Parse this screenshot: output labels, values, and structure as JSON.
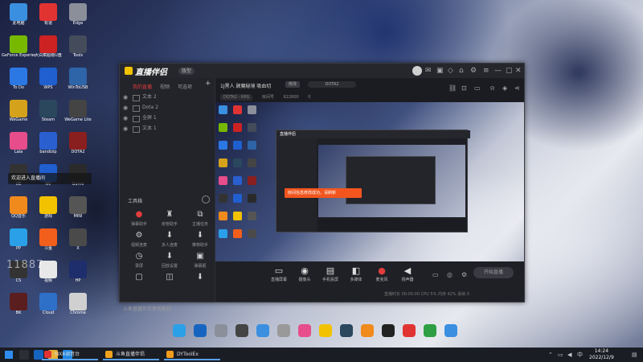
{
  "desktop": {
    "icons": [
      {
        "label": "此电脑",
        "color": "#3b8fe0"
      },
      {
        "label": "有道",
        "color": "#e23333"
      },
      {
        "label": "Edge",
        "color": "#8a8f9a"
      },
      {
        "label": "GeForce Experience",
        "color": "#76b900"
      },
      {
        "label": "大白菜超级U盘",
        "color": "#cc2222"
      },
      {
        "label": "Tools",
        "color": "#444b5a"
      },
      {
        "label": "To Do",
        "color": "#2b78e4"
      },
      {
        "label": "WPS",
        "color": "#1f5fcf"
      },
      {
        "label": "WinToUSB",
        "color": "#2e64a8"
      },
      {
        "label": "WeGame",
        "color": "#d4a21b"
      },
      {
        "label": "Steam",
        "color": "#2a475e"
      },
      {
        "label": "WeGame Lite",
        "color": "#444"
      },
      {
        "label": "Lala",
        "color": "#e64d8a"
      },
      {
        "label": "bandizip",
        "color": "#2a5fd0"
      },
      {
        "label": "DOTA2",
        "color": "#8a1f1f"
      },
      {
        "label": "UE",
        "color": "#333"
      },
      {
        "label": "NV",
        "color": "#1f5fcf"
      },
      {
        "label": "Game",
        "color": "#2a2a2a"
      },
      {
        "label": "QQ音乐",
        "color": "#f08a1c"
      },
      {
        "label": "游戏",
        "color": "#f2c200"
      },
      {
        "label": "MINI",
        "color": "#555"
      },
      {
        "label": "PP",
        "color": "#2aa0e8"
      },
      {
        "label": "斗鱼",
        "color": "#f25e1c"
      },
      {
        "label": "X",
        "color": "#4a4a4a"
      },
      {
        "label": "CS",
        "color": "#333"
      },
      {
        "label": "视频",
        "color": "#e8e8e8"
      },
      {
        "label": "HP",
        "color": "#1e2d6b"
      },
      {
        "label": "BK",
        "color": "#5a1e1e"
      },
      {
        "label": "Cloud",
        "color": "#2e70c8"
      },
      {
        "label": "Chrome",
        "color": "#d0d0d0"
      }
    ],
    "watermark": "11887",
    "toast": "欢迎进入直播间"
  },
  "window": {
    "app_title": "直播伴侣",
    "version_badge": "版型"
  },
  "left_panel": {
    "tabs": [
      "我的直播",
      "视频",
      "可选项"
    ],
    "scenes": [
      "文本 2",
      "Dota 2",
      "全屏 1",
      "文本 1"
    ],
    "tools_title": "工具箱",
    "tools": [
      {
        "icon": "●",
        "label": "弹幕助手"
      },
      {
        "icon": "♜",
        "label": "房管助手"
      },
      {
        "icon": "⧉",
        "label": "主播任务"
      },
      {
        "icon": "⚙",
        "label": "视频连麦"
      },
      {
        "icon": "⬇",
        "label": "多人连麦"
      },
      {
        "icon": "⬇",
        "label": "推荐助手"
      },
      {
        "icon": "◷",
        "label": "录屏"
      },
      {
        "icon": "⬇",
        "label": "回放设置"
      },
      {
        "icon": "▣",
        "label": "弹幕姬"
      },
      {
        "icon": "▢",
        "label": ""
      },
      {
        "icon": "◫",
        "label": ""
      },
      {
        "icon": "⬇",
        "label": ""
      }
    ],
    "help_link": "斗鱼直播伴侣使用教程"
  },
  "right_panel": {
    "room_title": "1J黑人 顾魔秘境 吸血切",
    "edit_label": "修改",
    "category": "DOTA2",
    "stats": {
      "tag": "DOTA2 - RPG",
      "room_id": "房间号",
      "fans": "622800",
      "online": "0"
    },
    "notify": "房间信息修改成功，请刷新",
    "controls": [
      {
        "icon": "▭",
        "label": "直播屏幕"
      },
      {
        "icon": "◉",
        "label": "摄像头"
      },
      {
        "icon": "▤",
        "label": "手机投屏"
      },
      {
        "icon": "◧",
        "label": "多媒体"
      },
      {
        "icon": "●",
        "label": "麦克风"
      },
      {
        "icon": "◀",
        "label": "扬声器"
      }
    ],
    "start_button": "开始直播",
    "status_text": "直播时长 00:00:00    CPU 5%    内存 42%    丢帧 0"
  },
  "taskbar": {
    "tasks": [
      {
        "label": "MX8调音台",
        "color": "#e23333"
      },
      {
        "label": "斗鱼直播伴侣",
        "color": "#f2a21c"
      },
      {
        "label": "DYToolEx",
        "color": "#f29c1c"
      }
    ],
    "time": "14:24",
    "date": "2022/12/9",
    "lang": "中"
  }
}
